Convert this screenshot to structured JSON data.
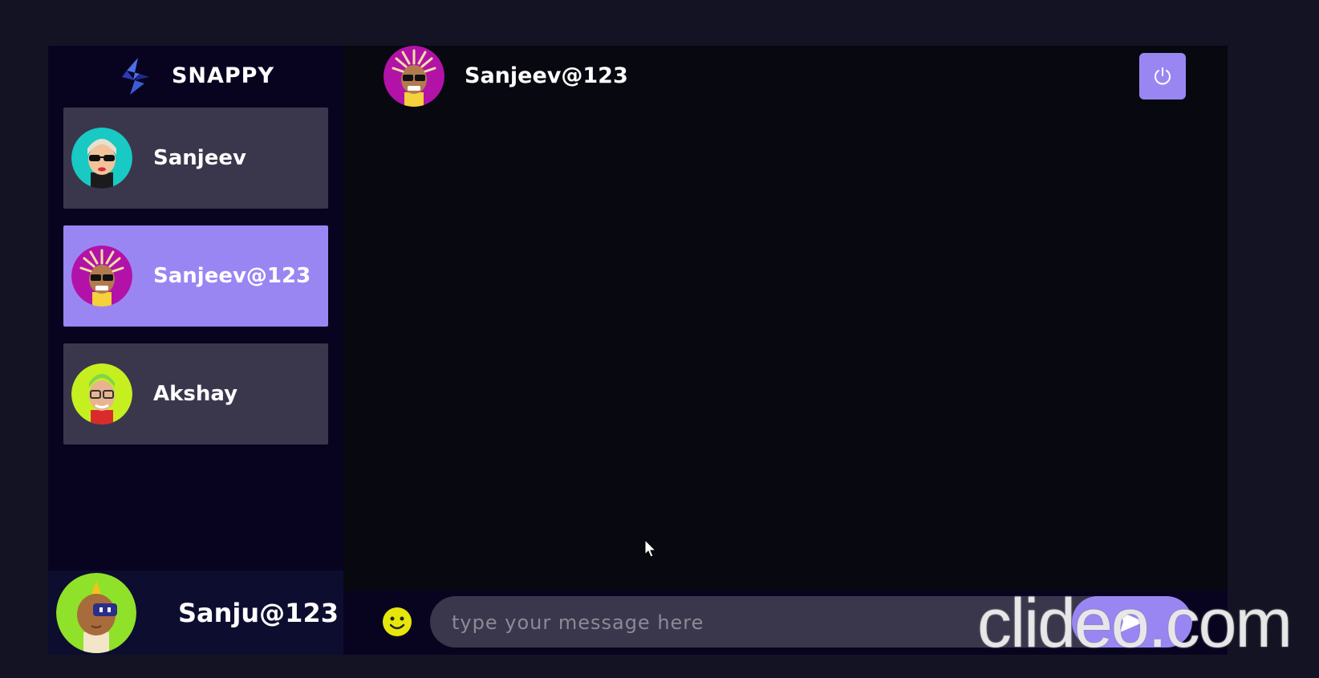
{
  "brand": {
    "name": "SNAPPY",
    "logo_icon": "snappy-logo-icon"
  },
  "contacts": [
    {
      "name": "Sanjeev",
      "avatar": "avatar-sunglasses-teal",
      "selected": false
    },
    {
      "name": "Sanjeev@123",
      "avatar": "avatar-dreadlocks-magenta",
      "selected": true
    },
    {
      "name": "Akshay",
      "avatar": "avatar-glasses-lime",
      "selected": false
    }
  ],
  "current_user": {
    "username": "Sanju@123",
    "avatar": "avatar-robot-visor-green"
  },
  "chat": {
    "header_name": "Sanjeev@123",
    "logout_icon": "power-icon",
    "input_placeholder": "type your message here",
    "input_value": "",
    "emoji_icon": "smiley-icon",
    "send_icon": "send-icon"
  },
  "watermark": {
    "text": "clideo.com"
  },
  "colors": {
    "background": "#131324",
    "sidebar": "#080420",
    "accent": "#9a86f3",
    "contact_bg": "#ffffff34"
  }
}
